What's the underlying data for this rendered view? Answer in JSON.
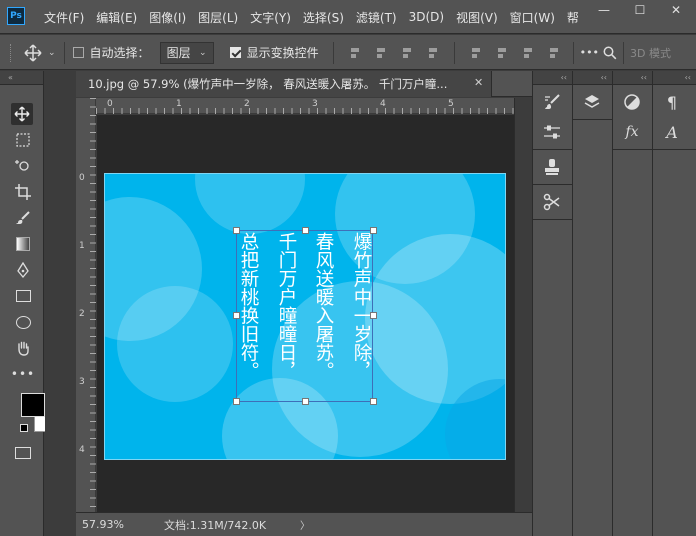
{
  "app": {
    "logo": "Ps"
  },
  "menu": [
    "文件(F)",
    "编辑(E)",
    "图像(I)",
    "图层(L)",
    "文字(Y)",
    "选择(S)",
    "滤镜(T)",
    "3D(D)",
    "视图(V)",
    "窗口(W)",
    "帮"
  ],
  "window_buttons": [
    "—",
    "☐",
    "✕"
  ],
  "options": {
    "auto_select_label": "自动选择：",
    "auto_select_checked": false,
    "target_value": "图层",
    "show_transform_label": "显示变换控件",
    "show_transform_checked": true,
    "mode3d_label": "3D 模式"
  },
  "document": {
    "tab_title": "10.jpg @ 57.9% (爆竹声中一岁除， 春风送暖入屠苏。 千门万户瞳...",
    "ruler_h_labels": [
      "0",
      "1",
      "2",
      "3",
      "4",
      "5"
    ],
    "ruler_v_labels": [
      "0",
      "1",
      "2",
      "3",
      "4"
    ]
  },
  "status": {
    "zoom": "57.93%",
    "doc_info": "文档:1.31M/742.0K",
    "arrow": "〉"
  },
  "poem_columns": [
    "爆竹声中一岁除，",
    "春风送暖入屠苏。",
    "千门万户曈曈日，",
    "总把新桃换旧符。"
  ],
  "colors": {
    "canvas_bg": "#00b4ec",
    "ui": "#535353",
    "dark": "#282828",
    "accent": "#31a8ff"
  },
  "panels": {
    "col1_icons": [
      "brush-settings-icon",
      "adjust-icon",
      "stamp-icon",
      "scissors-icon"
    ],
    "col2_icons": [
      "layers-icon"
    ],
    "col3_icons": [
      "adjustments-circle-icon",
      "styles-fx-icon"
    ],
    "col4_icons": [
      "paragraph-icon",
      "character-icon"
    ]
  }
}
